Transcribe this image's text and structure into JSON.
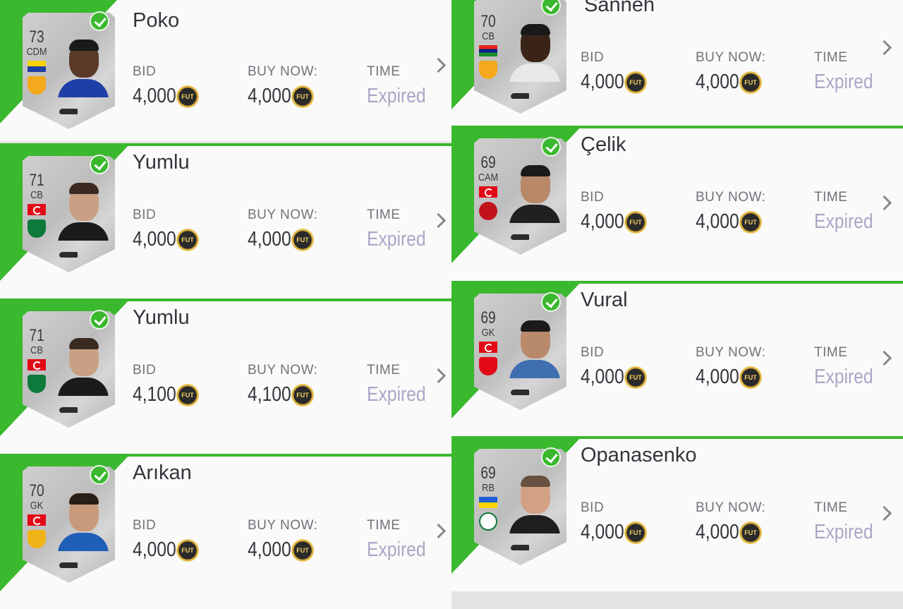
{
  "labels": {
    "bid": "BID",
    "buy_now": "BUY NOW:",
    "time": "TIME",
    "coin": "FUT"
  },
  "colors": {
    "accent_green": "#3ab82e",
    "expired_text": "#a9a7c6",
    "card_silver": "#c4c4c4"
  },
  "left_items": [
    {
      "name": "Poko",
      "rating": "73",
      "position": "CDM",
      "nation_flag": "guyana-flag",
      "club_badge": "goztepe-badge",
      "bid": "4,000",
      "buy_now": "4,000",
      "time": "Expired"
    },
    {
      "name": "Yumlu",
      "rating": "71",
      "position": "CB",
      "nation_flag": "turkey-flag",
      "club_badge": "denizlispor-badge",
      "bid": "4,000",
      "buy_now": "4,000",
      "time": "Expired"
    },
    {
      "name": "Yumlu",
      "rating": "71",
      "position": "CB",
      "nation_flag": "turkey-flag",
      "club_badge": "denizlispor-badge",
      "bid": "4,100",
      "buy_now": "4,100",
      "time": "Expired"
    },
    {
      "name": "Arıkan",
      "rating": "70",
      "position": "GK",
      "nation_flag": "turkey-flag",
      "club_badge": "kayserispor-badge",
      "bid": "4,000",
      "buy_now": "4,000",
      "time": "Expired"
    }
  ],
  "right_items": [
    {
      "name": "Sanneh",
      "rating": "70",
      "position": "CB",
      "nation_flag": "gambia-flag",
      "club_badge": "goztepe-badge",
      "bid": "4,000",
      "buy_now": "4,000",
      "time": "Expired"
    },
    {
      "name": "Çelik",
      "rating": "69",
      "position": "CAM",
      "nation_flag": "turkey-flag",
      "club_badge": "gaziantep-badge",
      "bid": "4,000",
      "buy_now": "4,000",
      "time": "Expired"
    },
    {
      "name": "Vural",
      "rating": "69",
      "position": "GK",
      "nation_flag": "turkey-flag",
      "club_badge": "sivasspor-badge",
      "bid": "4,000",
      "buy_now": "4,000",
      "time": "Expired"
    },
    {
      "name": "Opanasenko",
      "rating": "69",
      "position": "RB",
      "nation_flag": "ukraine-flag",
      "club_badge": "konyaspor-badge",
      "bid": "4,000",
      "buy_now": "4,000",
      "time": "Expired"
    }
  ]
}
